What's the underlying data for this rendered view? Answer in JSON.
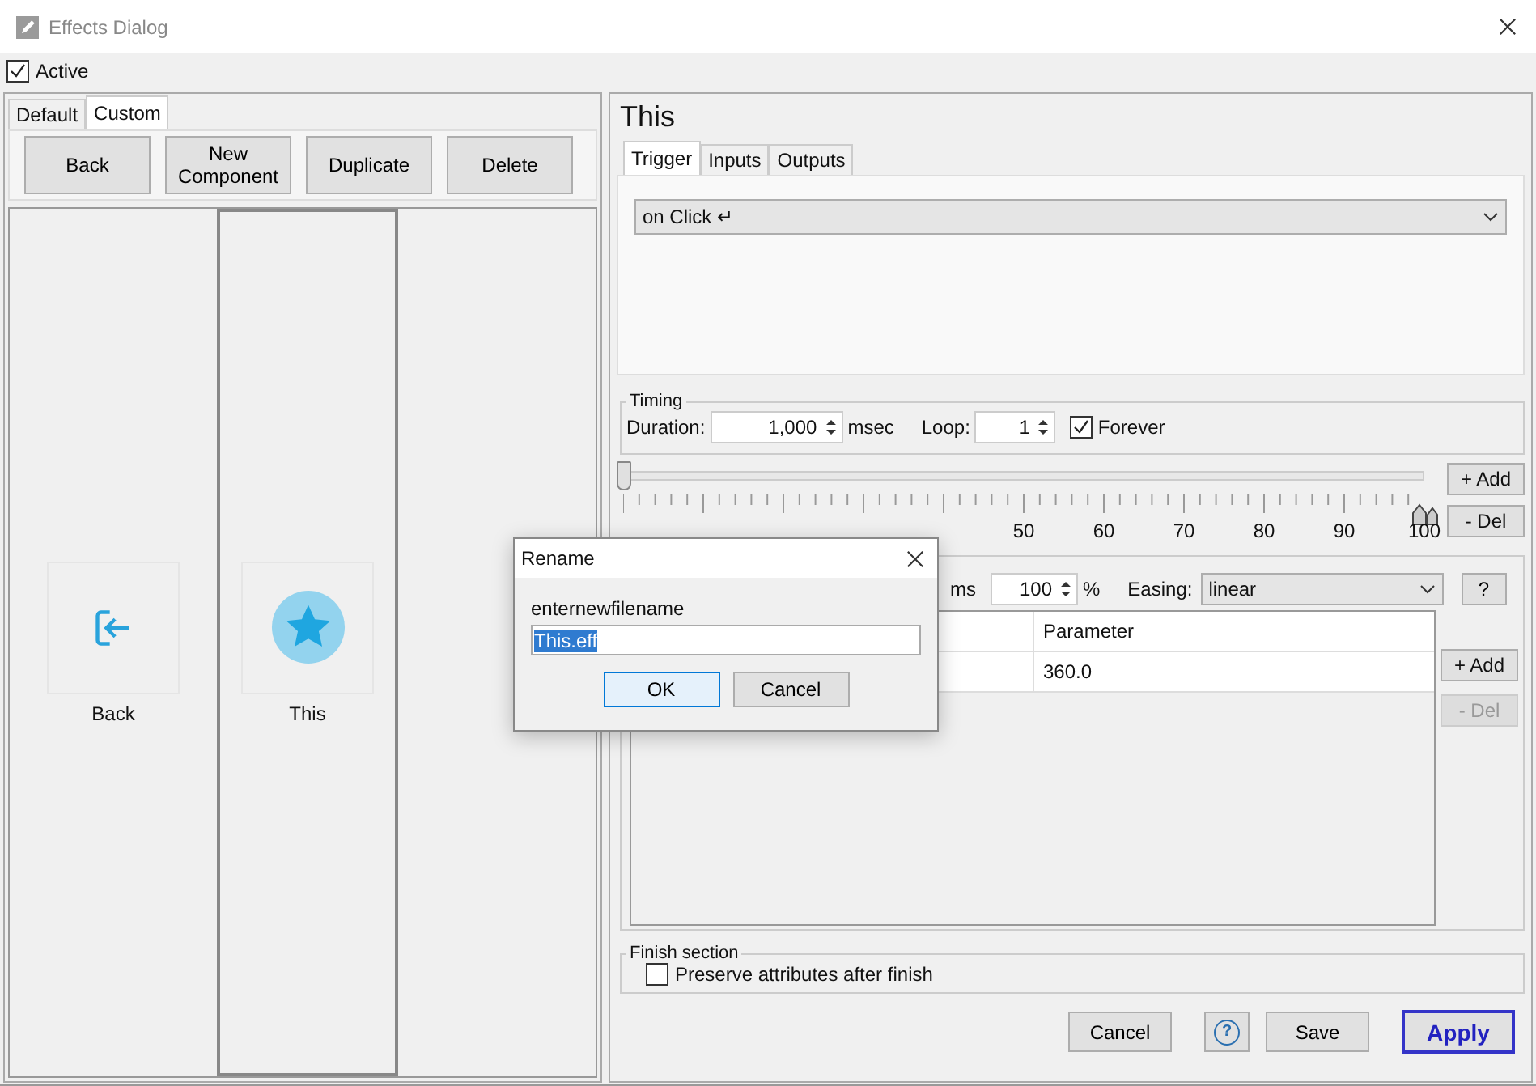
{
  "window": {
    "title": "Effects Dialog"
  },
  "active": {
    "label": "Active",
    "checked": true
  },
  "left_tabs": [
    {
      "label": "Default",
      "selected": false
    },
    {
      "label": "Custom",
      "selected": true
    }
  ],
  "toolbar_buttons": [
    "Back",
    "New Component",
    "Duplicate",
    "Delete"
  ],
  "components": [
    {
      "label": "Back",
      "kind": "back",
      "selected": false
    },
    {
      "label": "This",
      "kind": "star",
      "selected": true
    }
  ],
  "effect": {
    "title": "This",
    "tabs": [
      {
        "label": "Trigger",
        "selected": true
      },
      {
        "label": "Inputs",
        "selected": false
      },
      {
        "label": "Outputs",
        "selected": false
      }
    ],
    "trigger": "on Click ↵",
    "timing": {
      "legend": "Timing",
      "duration_label": "Duration:",
      "duration": "1,000",
      "duration_unit": "msec",
      "loop_label": "Loop:",
      "loop": "1",
      "forever": {
        "label": "Forever",
        "checked": true
      }
    },
    "timeline": {
      "level": 0,
      "tick_labels": [
        "50",
        "60",
        "70",
        "80",
        "90",
        "100"
      ],
      "add": "+ Add",
      "del": "- Del"
    },
    "keyframe": {
      "unit_label": "ms",
      "percent": "100",
      "percent_unit": "%",
      "easing_label": "Easing:",
      "easing": "linear",
      "help": "?",
      "columns": [
        "Parameter"
      ],
      "rows": [
        [
          "360.0"
        ]
      ],
      "add": {
        "label": "+ Add",
        "disabled": false
      },
      "del": {
        "label": "- Del",
        "disabled": true
      }
    },
    "finish": {
      "legend": "Finish section",
      "preserve": {
        "label": "Preserve attributes after finish",
        "checked": false
      }
    }
  },
  "footer_buttons": [
    {
      "label": "Cancel",
      "kind": "normal"
    },
    {
      "label": "?",
      "kind": "help"
    },
    {
      "label": "Save",
      "kind": "normal"
    },
    {
      "label": "Apply",
      "kind": "default"
    }
  ],
  "rename": {
    "title": "Rename",
    "prompt": "enternewfilename",
    "value": "This.eff",
    "buttons": [
      {
        "label": "OK",
        "kind": "default"
      },
      {
        "label": "Cancel",
        "kind": "normal"
      }
    ]
  }
}
